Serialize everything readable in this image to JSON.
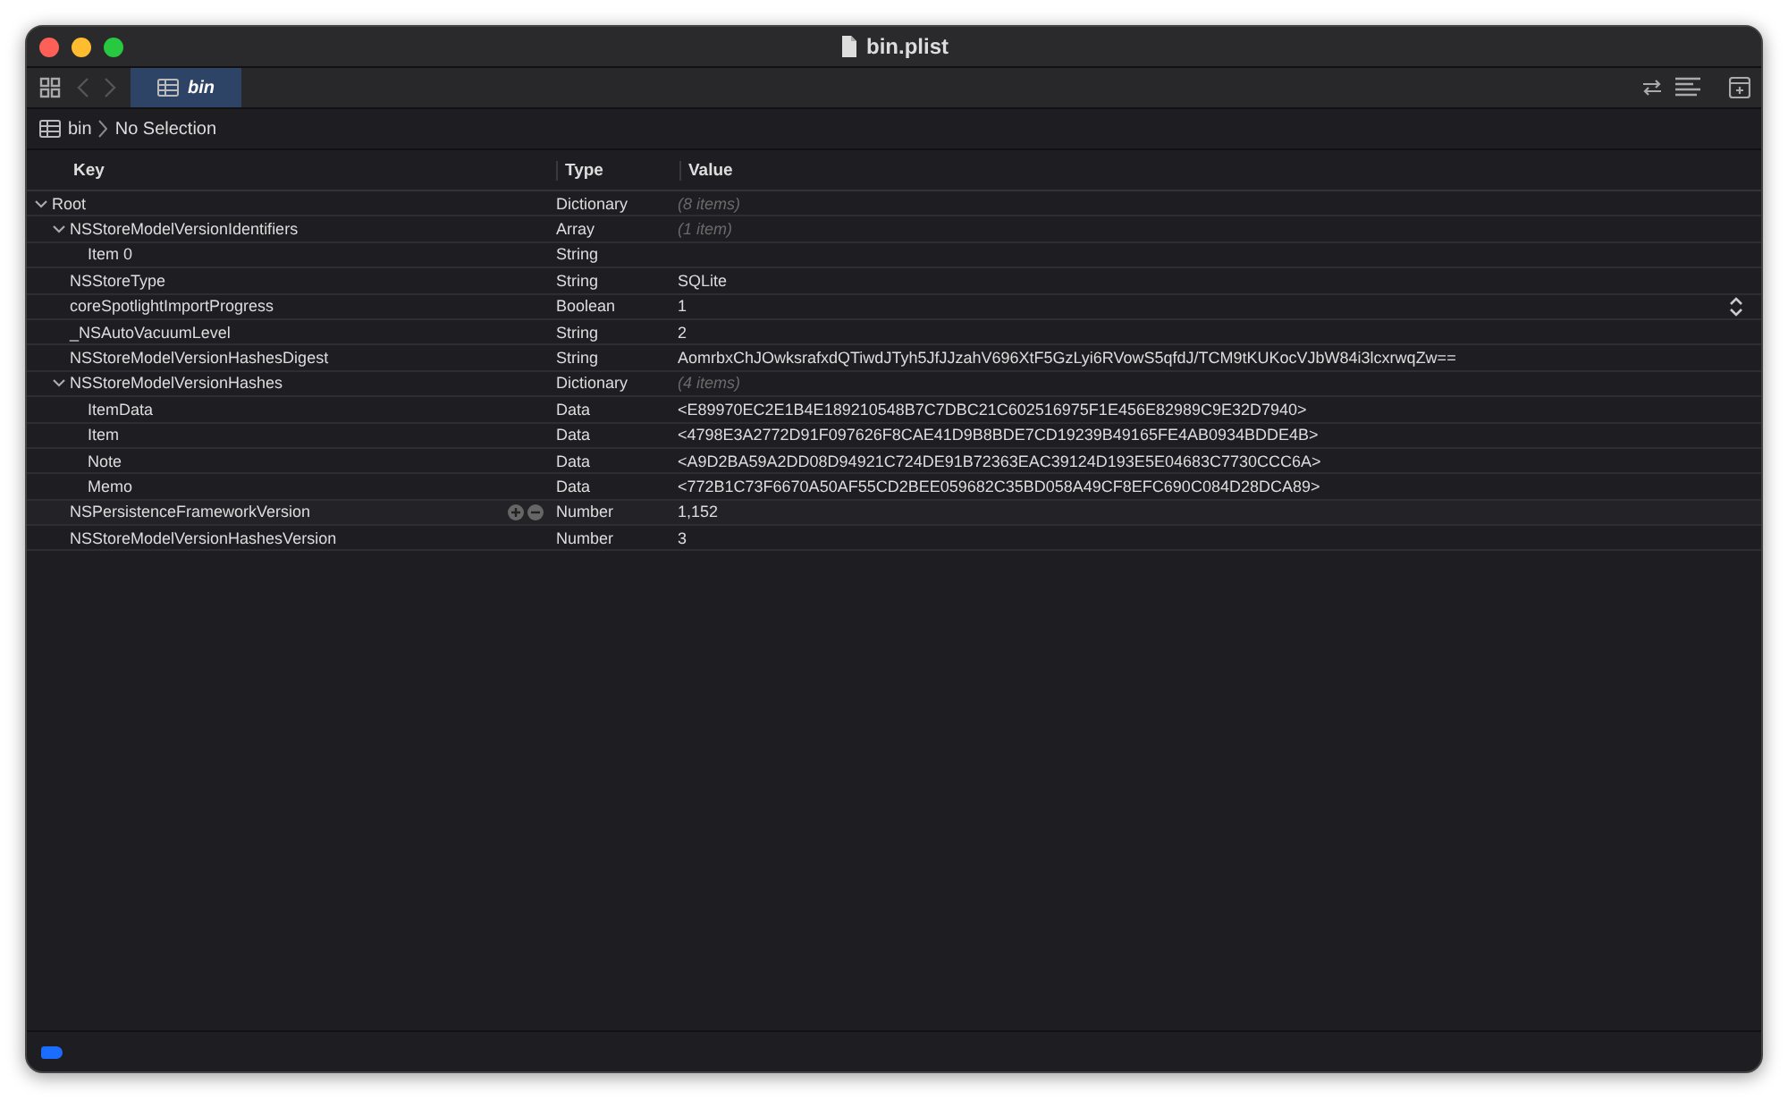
{
  "window": {
    "title": "bin.plist"
  },
  "tabs": [
    {
      "label": "bin",
      "selected": true
    }
  ],
  "breadcrumb": {
    "file": "bin",
    "selection": "No Selection"
  },
  "table": {
    "columns": [
      "Key",
      "Type",
      "Value"
    ],
    "rows": [
      {
        "key": "Root",
        "type": "Dictionary",
        "value": "(8 items)",
        "summary": true,
        "expanded": true,
        "hovered": false,
        "kind": "container",
        "children": [
          {
            "key": "NSStoreModelVersionIdentifiers",
            "type": "Array",
            "value": "(1 item)",
            "summary": true,
            "expanded": true,
            "hovered": false,
            "kind": "container",
            "children": [
              {
                "key": "Item 0",
                "type": "String",
                "hovered": false,
                "kind": "plain"
              }
            ]
          },
          {
            "key": "NSStoreType",
            "type": "String",
            "value": "SQLite",
            "summary": false,
            "hovered": false,
            "kind": "plain"
          },
          {
            "key": "coreSpotlightImportProgress",
            "type": "Boolean",
            "value": "1",
            "summary": false,
            "hovered": false,
            "kind": "boolean"
          },
          {
            "key": "_NSAutoVacuumLevel",
            "type": "String",
            "value": "2",
            "summary": false,
            "hovered": false,
            "kind": "plain"
          },
          {
            "key": "NSStoreModelVersionHashesDigest",
            "type": "String",
            "value": "AomrbxChJOwksrafxdQTiwdJTyh5JfJJzahV696XtF5GzLyi6RVowS5qfdJ/TCM9tKUKocVJbW84i3lcxrwqZw==",
            "summary": false,
            "hovered": false,
            "kind": "plain"
          },
          {
            "key": "NSStoreModelVersionHashes",
            "type": "Dictionary",
            "value": "(4 items)",
            "summary": true,
            "expanded": true,
            "hovered": false,
            "kind": "container",
            "children": [
              {
                "key": "ItemData",
                "type": "Data",
                "value": "<E89970EC2E1B4E189210548B7C7DBC21C602516975F1E456E82989C9E32D7940>",
                "summary": false,
                "hovered": false,
                "kind": "plain"
              },
              {
                "key": "Item",
                "type": "Data",
                "value": "<4798E3A2772D91F097626F8CAE41D9B8BDE7CD19239B49165FE4AB0934BDDE4B>",
                "summary": false,
                "hovered": false,
                "kind": "plain"
              },
              {
                "key": "Note",
                "type": "Data",
                "value": "<A9D2BA59A2DD08D94921C724DE91B72363EAC39124D193E5E04683C7730CCC6A>",
                "summary": false,
                "hovered": false,
                "kind": "plain"
              },
              {
                "key": "Memo",
                "type": "Data",
                "value": "<772B1C73F6670A50AF55CD2BEE059682C35BD058A49CF8EFC690C084D28DCA89>",
                "summary": false,
                "hovered": false,
                "kind": "plain"
              }
            ]
          },
          {
            "key": "NSPersistenceFrameworkVersion",
            "type": "Number",
            "value": "1,152",
            "summary": false,
            "hovered": true,
            "kind": "plain"
          },
          {
            "key": "NSStoreModelVersionHashesVersion",
            "type": "Number",
            "value": "3",
            "summary": false,
            "hovered": false,
            "kind": "plain"
          }
        ]
      }
    ]
  }
}
